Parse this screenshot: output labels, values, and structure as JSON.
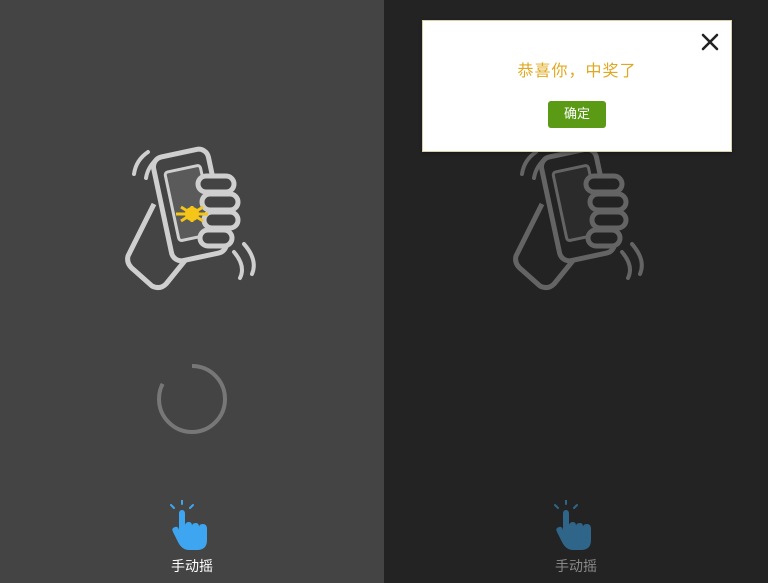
{
  "left_screen": {
    "manual_shake_label": "手动摇",
    "illustration_icon": "shake-phone-hand-icon",
    "spinner_icon": "loading-spinner-icon",
    "manual_shake_icon": "tap-hand-icon"
  },
  "right_screen": {
    "manual_shake_label": "手动摇",
    "dialog": {
      "message": "恭喜你，中奖了",
      "confirm_label": "确定",
      "close_icon": "close-icon"
    }
  },
  "colors": {
    "left_background": "#444444",
    "right_background": "#232323",
    "message_color": "#e0a820",
    "confirm_button": "#5a9a14",
    "hand_icon": "#3ea6f0"
  }
}
